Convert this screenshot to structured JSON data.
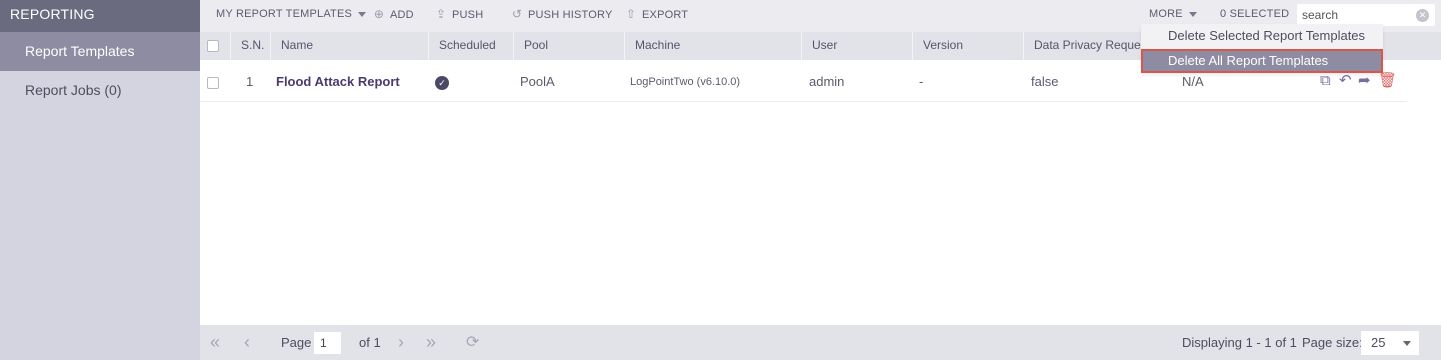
{
  "sidebar": {
    "title": "REPORTING",
    "items": [
      {
        "label": "Report Templates",
        "active": true
      },
      {
        "label": "Report Jobs (0)",
        "active": false
      }
    ]
  },
  "toolbar": {
    "templates_menu": "MY REPORT TEMPLATES",
    "add": "ADD",
    "push": "PUSH",
    "push_history": "PUSH HISTORY",
    "export": "EXPORT",
    "more": "MORE",
    "selected": "0 SELECTED",
    "search_placeholder": "search",
    "search_value": ""
  },
  "more_menu": {
    "items": [
      {
        "label": "Delete Selected Report Templates",
        "highlighted": false
      },
      {
        "label": "Delete All Report Templates",
        "highlighted": true
      }
    ]
  },
  "table": {
    "columns": [
      "S.N.",
      "Name",
      "Scheduled",
      "Pool",
      "Machine",
      "User",
      "Version",
      "Data Privacy Reques"
    ],
    "rows": [
      {
        "sn": "1",
        "name": "Flood Attack Report",
        "scheduled": true,
        "pool": "PoolA",
        "machine": "LogPointTwo (v6.10.0)",
        "user": "admin",
        "version": "-",
        "data_privacy": "false",
        "extra": "N/A",
        "actions": [
          "copy-icon",
          "reply-icon",
          "share-icon",
          "trash-icon"
        ]
      }
    ]
  },
  "pager": {
    "page_label": "Page",
    "page_value": "1",
    "of_label": "of 1",
    "displaying": "Displaying 1 - 1 of 1",
    "page_size_label": "Page size:",
    "page_size": "25"
  },
  "colors": {
    "sidebar_bg": "#d4d4e0",
    "sidebar_header": "#6b6b80",
    "active_item": "#8d8ca2",
    "highlight_border": "#d9574a",
    "name_text": "#4b3a6e",
    "delete_icon": "#e06060"
  }
}
